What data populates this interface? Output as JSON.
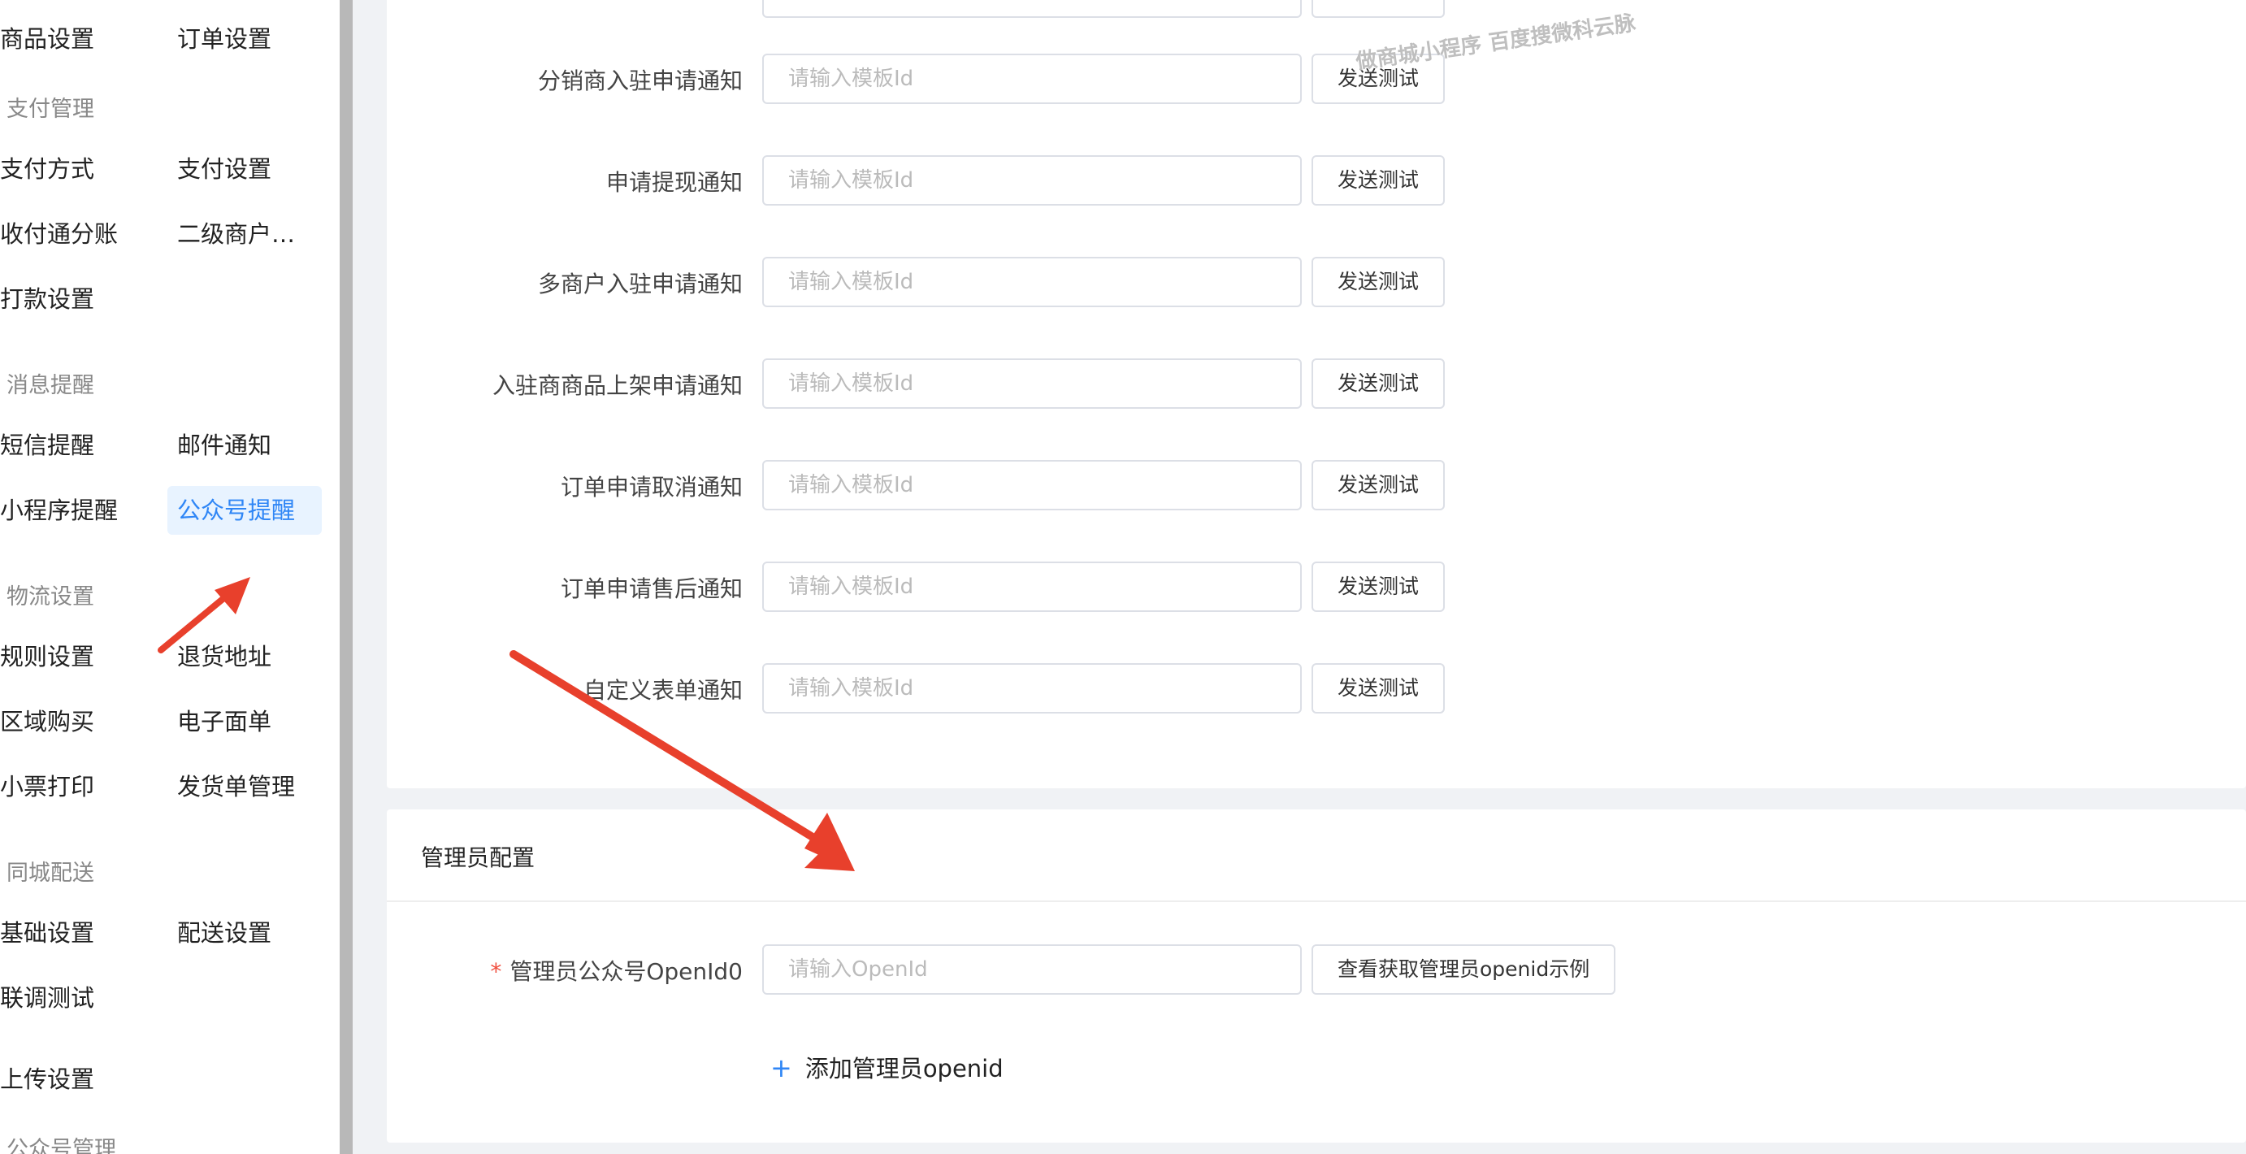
{
  "sidebar": {
    "row0": {
      "left": "商品设置",
      "right": "订单设置"
    },
    "payment_section": "支付管理",
    "payment_rows": [
      {
        "left": "支付方式",
        "right": "支付设置"
      },
      {
        "left": "收付通分账",
        "right": "二级商户进件"
      },
      {
        "left": "打款设置",
        "right": ""
      }
    ],
    "message_section": "消息提醒",
    "message_rows": [
      {
        "left": "短信提醒",
        "right": "邮件通知"
      },
      {
        "left": "小程序提醒",
        "right": "公众号提醒"
      }
    ],
    "logistics_section": "物流设置",
    "logistics_rows": [
      {
        "left": "规则设置",
        "right": "退货地址"
      },
      {
        "left": "区域购买",
        "right": "电子面单"
      },
      {
        "left": "小票打印",
        "right": "发货单管理"
      }
    ],
    "delivery_section": "同城配送",
    "delivery_rows": [
      {
        "left": "基础设置",
        "right": "配送设置"
      },
      {
        "left": "联调测试",
        "right": ""
      }
    ],
    "upload_item": "上传设置",
    "official_section": "公众号管理"
  },
  "template_rows": [
    {
      "label": "分销商入驻申请通知",
      "placeholder": "请输入模板Id",
      "button": "发送测试"
    },
    {
      "label": "申请提现通知",
      "placeholder": "请输入模板Id",
      "button": "发送测试"
    },
    {
      "label": "多商户入驻申请通知",
      "placeholder": "请输入模板Id",
      "button": "发送测试"
    },
    {
      "label": "入驻商商品上架申请通知",
      "placeholder": "请输入模板Id",
      "button": "发送测试"
    },
    {
      "label": "订单申请取消通知",
      "placeholder": "请输入模板Id",
      "button": "发送测试"
    },
    {
      "label": "订单申请售后通知",
      "placeholder": "请输入模板Id",
      "button": "发送测试"
    },
    {
      "label": "自定义表单通知",
      "placeholder": "请输入模板Id",
      "button": "发送测试"
    }
  ],
  "admin": {
    "title": "管理员配置",
    "required_mark": "*",
    "openid_label": "管理员公众号OpenId0",
    "openid_placeholder": "请输入OpenId",
    "example_button": "查看获取管理员openid示例",
    "add_plus": "+",
    "add_label": "添加管理员openid"
  },
  "watermark": "做商城小程序 百度搜微科云脉",
  "colors": {
    "accent": "#2f86f6",
    "arrow": "#e8402c",
    "required": "#f04e3e"
  }
}
